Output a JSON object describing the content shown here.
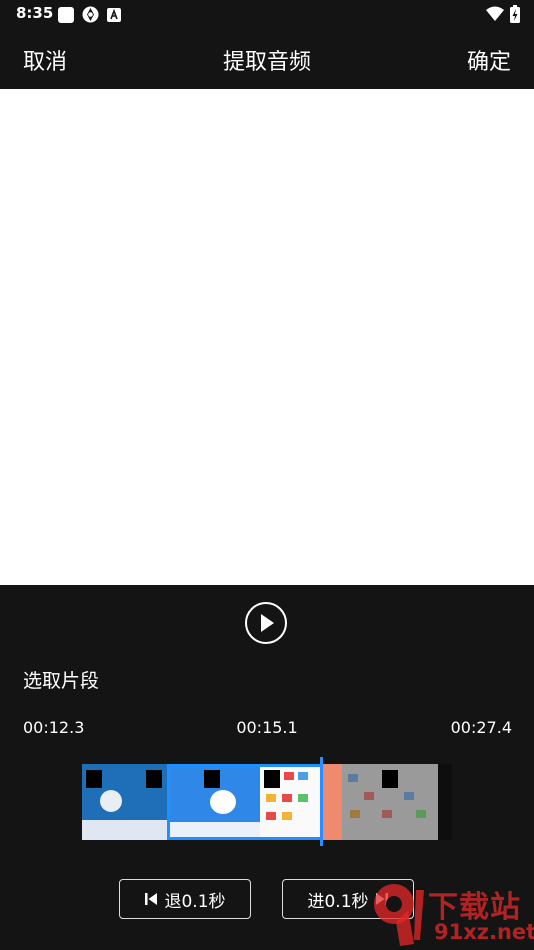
{
  "status_bar": {
    "time": "8:35",
    "icons_left": [
      "square-notification-icon",
      "aperture-icon",
      "a-badge-icon"
    ],
    "icons_right": [
      "wifi-icon",
      "battery-charging-icon"
    ]
  },
  "title_bar": {
    "cancel_label": "取消",
    "title": "提取音频",
    "confirm_label": "确定"
  },
  "player": {
    "play_icon": "play-icon"
  },
  "selection": {
    "label": "选取片段",
    "start_time": "00:12.3",
    "current_time": "00:15.1",
    "end_time": "00:27.4"
  },
  "controls": {
    "back_label": "退0.1秒",
    "back_icon": "skip-previous-icon",
    "forward_label": "进0.1秒",
    "forward_icon": "skip-next-icon"
  },
  "colors": {
    "background": "#141414",
    "selection_border": "#1e90ff",
    "handle": "#f08a6e",
    "playhead": "#2d8cff"
  },
  "watermark": {
    "line1": "下载站",
    "line2": "91xz.net"
  }
}
